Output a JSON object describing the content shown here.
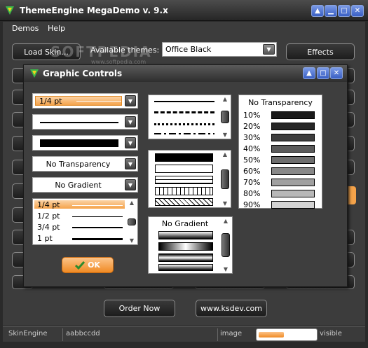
{
  "window": {
    "title": "ThemeEngine MegaDemo v. 9.x"
  },
  "menu": {
    "items": [
      "Demos",
      "Help"
    ]
  },
  "toolbar": {
    "load_skin": "Load Skin...",
    "themes_label": "Available themes:",
    "themes_value": "Office Black",
    "effects": "Effects"
  },
  "watermark": "SOFTPEDIA",
  "watermark_url": "www.softpedia.com",
  "dialog": {
    "title": "Graphic Controls",
    "width_combo_value": "1/4 pt",
    "transparency_combo_value": "No Transparency",
    "gradient_combo_value": "No Gradient",
    "width_list": [
      "1/4 pt",
      "1/2 pt",
      "3/4 pt",
      "1 pt"
    ],
    "transparency_header": "No Transparency",
    "transparency_levels": [
      "10%",
      "20%",
      "30%",
      "40%",
      "50%",
      "60%",
      "70%",
      "80%",
      "90%"
    ],
    "gradient_header": "No Gradient",
    "ok": "OK"
  },
  "bottom_buttons": {
    "order_now": "Order Now",
    "website": "www.ksdev.com"
  },
  "status": {
    "cells": [
      "SkinEngine",
      "aabbccdd",
      "image",
      "visible"
    ],
    "progress": 0.45
  },
  "colors": {
    "accent": "#f5a34a",
    "title_bg": "#2a2a2a",
    "transparency_fills": [
      "#1a1a1a",
      "#262626",
      "#3d3d3d",
      "#5a5a5a",
      "#6e6e6e",
      "#888888",
      "#a0a0a0",
      "#b8b8b8",
      "#d4d4d4"
    ]
  }
}
